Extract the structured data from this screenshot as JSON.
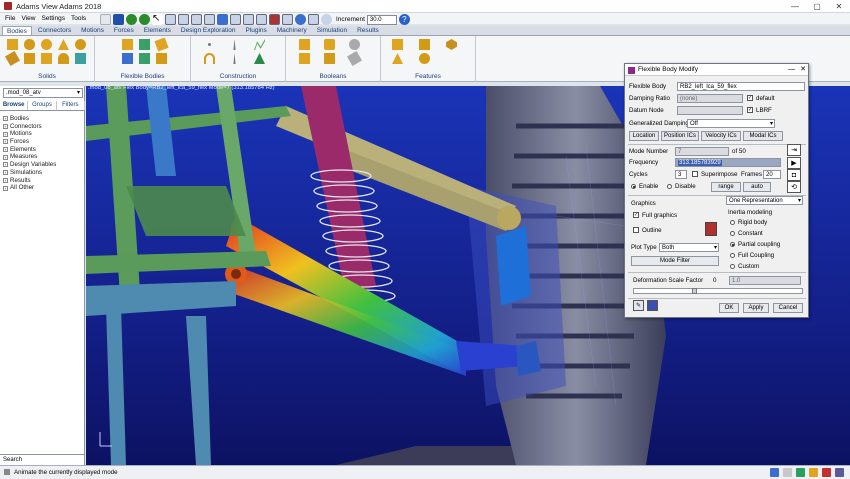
{
  "window": {
    "title": "Adams View Adams 2018",
    "minimize": "—",
    "maximize": "▢",
    "close": "✕"
  },
  "menu": [
    "File",
    "View",
    "Settings",
    "Tools"
  ],
  "toolbar": {
    "increment_label": "Increment",
    "increment_value": "30.0"
  },
  "tabs": [
    "Bodies",
    "Connectors",
    "Motions",
    "Forces",
    "Elements",
    "Design Exploration",
    "Plugins",
    "Machinery",
    "Simulation",
    "Results"
  ],
  "ribbon_groups": [
    "Solids",
    "Flexible Bodies",
    "Construction",
    "Booleans",
    "Features"
  ],
  "left_panel": {
    "model_select": ".mod_08_atv",
    "subtabs": [
      "Browse",
      "Groups",
      "Filters"
    ],
    "tree": [
      "Bodies",
      "Connectors",
      "Motions",
      "Forces",
      "Elements",
      "Measures",
      "Design Variables",
      "Simulations",
      "Results",
      "All Other"
    ],
    "search_label": "Search"
  },
  "viewport": {
    "header": ".mod_08_atv    Flex Body=RB2_left_lca_59_flex  Mode=7 (313.185784 Hz)"
  },
  "dialog": {
    "title": "Flexible Body Modify",
    "flexible_body_label": "Flexible Body",
    "flexible_body_value": "RB2_left_lca_59_flex",
    "damping_ratio_label": "Damping Ratio",
    "damping_ratio_value": "(none)",
    "default_label": "default",
    "datum_node_label": "Datum Node",
    "lbrf_label": "LBRF",
    "gen_damping_label": "Generalized Damping",
    "gen_damping_value": "Off",
    "tabs": [
      "Location",
      "Position ICs",
      "Velocity ICs",
      "Modal ICs"
    ],
    "mode_number_label": "Mode Number",
    "mode_number_value": "7",
    "of_label": "of 50",
    "frequency_label": "Frequency",
    "frequency_value": "313.185783929",
    "cycles_label": "Cycles",
    "cycles_value": "3",
    "superimpose_label": "Superimpose",
    "frames_label": "Frames",
    "frames_value": "20",
    "enable_label": "Enable",
    "disable_label": "Disable",
    "range_button": "range",
    "auto_button": "auto",
    "graphics_label": "Graphics",
    "full_graphics_label": "Full graphics",
    "outline_label": "Outline",
    "plot_type_label": "Plot Type",
    "plot_type_value": "Both",
    "mode_filter_button": "Mode Filter",
    "representation_value": "One Representation",
    "inertia_label": "Inertia modeling",
    "inertia_options": [
      "Rigid body",
      "Constant",
      "Partial coupling",
      "Full Coupling",
      "Custom"
    ],
    "deformation_label": "Deformation Scale Factor",
    "deformation_min": "0",
    "deformation_value": "1.0",
    "ok_button": "OK",
    "apply_button": "Apply",
    "cancel_button": "Cancel"
  },
  "status": {
    "message": "Animate the currently displayed mode"
  }
}
